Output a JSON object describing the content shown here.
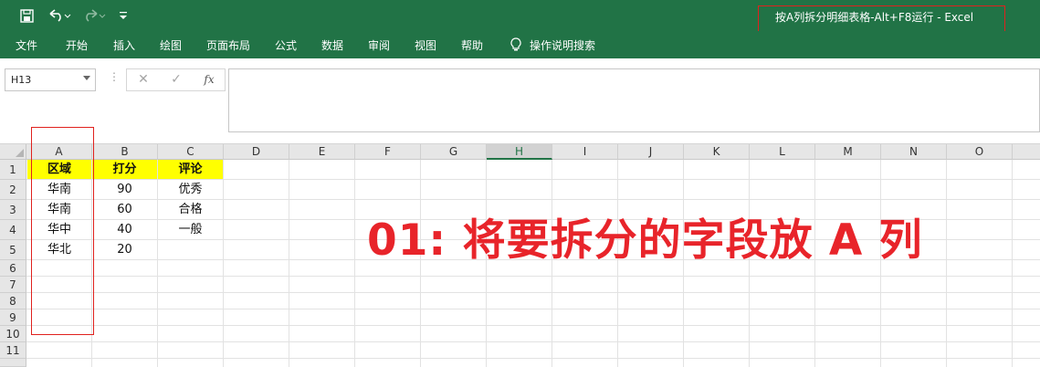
{
  "window": {
    "title": "按A列拆分明细表格-Alt+F8运行  -  Excel"
  },
  "quick_access": {
    "save_icon": "save-icon",
    "undo_icon": "undo-icon",
    "redo_icon": "redo-icon",
    "customize_icon": "customize-icon"
  },
  "ribbon": {
    "tabs": [
      "文件",
      "开始",
      "插入",
      "绘图",
      "页面布局",
      "公式",
      "数据",
      "审阅",
      "视图",
      "帮助"
    ],
    "tell_me": "操作说明搜索"
  },
  "formula_bar": {
    "name_box": "H13",
    "cancel_glyph": "✕",
    "enter_glyph": "✓",
    "fx_glyph": "fx",
    "value": ""
  },
  "sheet": {
    "columns": [
      "A",
      "B",
      "C",
      "D",
      "E",
      "F",
      "G",
      "H",
      "I",
      "J",
      "K",
      "L",
      "M",
      "N",
      "O"
    ],
    "selected_column": "H",
    "rows": [
      "1",
      "2",
      "3",
      "4",
      "5",
      "6",
      "7",
      "8",
      "9",
      "10",
      "11"
    ],
    "header_row": [
      "区域",
      "打分",
      "评论"
    ],
    "data_rows": [
      [
        "华南",
        "90",
        "优秀"
      ],
      [
        "华南",
        "60",
        "合格"
      ],
      [
        "华中",
        "40",
        "一般"
      ],
      [
        "华北",
        "20",
        ""
      ]
    ],
    "header_fill": "#ffff00"
  },
  "annotation": {
    "text": "01: 将要拆分的字段放 A 列",
    "color": "#e8242a"
  },
  "colors": {
    "excel_green": "#217346",
    "highlight_red": "#e0211e"
  }
}
